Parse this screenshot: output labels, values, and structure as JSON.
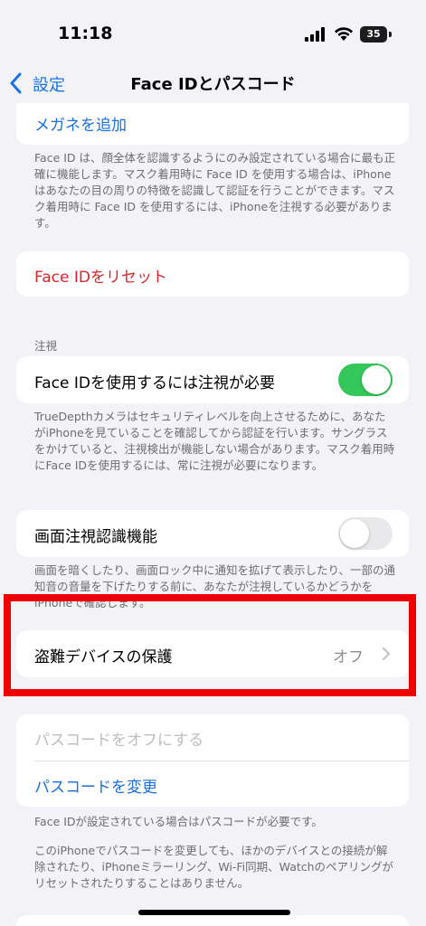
{
  "status": {
    "time": "11:18",
    "battery": "35"
  },
  "nav": {
    "back_label": "設定",
    "title": "Face IDとパスコード"
  },
  "glasses": {
    "add_label": "メガネを追加"
  },
  "glasses_footnote": "Face ID は、顔全体を認識するようにのみ設定されている場合に最も正確に機能します。マスク着用時に Face ID を使用する場合は、iPhoneはあなたの目の周りの特徴を認識して認証を行うことができます。マスク着用時に Face ID を使用するには、iPhoneを注視する必要があります。",
  "reset": {
    "label": "Face IDをリセット"
  },
  "attention": {
    "header": "注視",
    "require_label": "Face IDを使用するには注視が必要",
    "require_on": true,
    "require_footnote": "TrueDepthカメラはセキュリティレベルを向上させるために、あなたがiPhoneを見ていることを確認してから認証を行います。サングラスをかけていると、注視検出が機能しない場合があります。マスク着用時にFace IDを使用するには、常に注視が必要になります。",
    "aware_label": "画面注視認識機能",
    "aware_on": false,
    "aware_footnote": "画面を暗くしたり、画面ロック中に通知を拡げて表示したり、一部の通知音の音量を下げたりする前に、あなたが注視しているかどうかをiPhoneで確認します。"
  },
  "stolen": {
    "label": "盗難デバイスの保護",
    "value": "オフ"
  },
  "passcode": {
    "turn_off_label": "パスコードをオフにする",
    "change_label": "パスコードを変更",
    "footnote_1": "Face IDが設定されている場合はパスコードが必要です。",
    "footnote_2": "このiPhoneでパスコードを変更しても、ほかのデバイスとの接続が解除されたり、iPhoneミラーリング、Wi-Fi同期、Watchのペアリングがリセットされたりすることはありません。"
  },
  "colors": {
    "accent": "#1a6fdc",
    "destructive": "#d7262e",
    "toggle_on": "#34c759",
    "toggle_off": "#e9e9eb",
    "highlight": "#ee0000"
  }
}
